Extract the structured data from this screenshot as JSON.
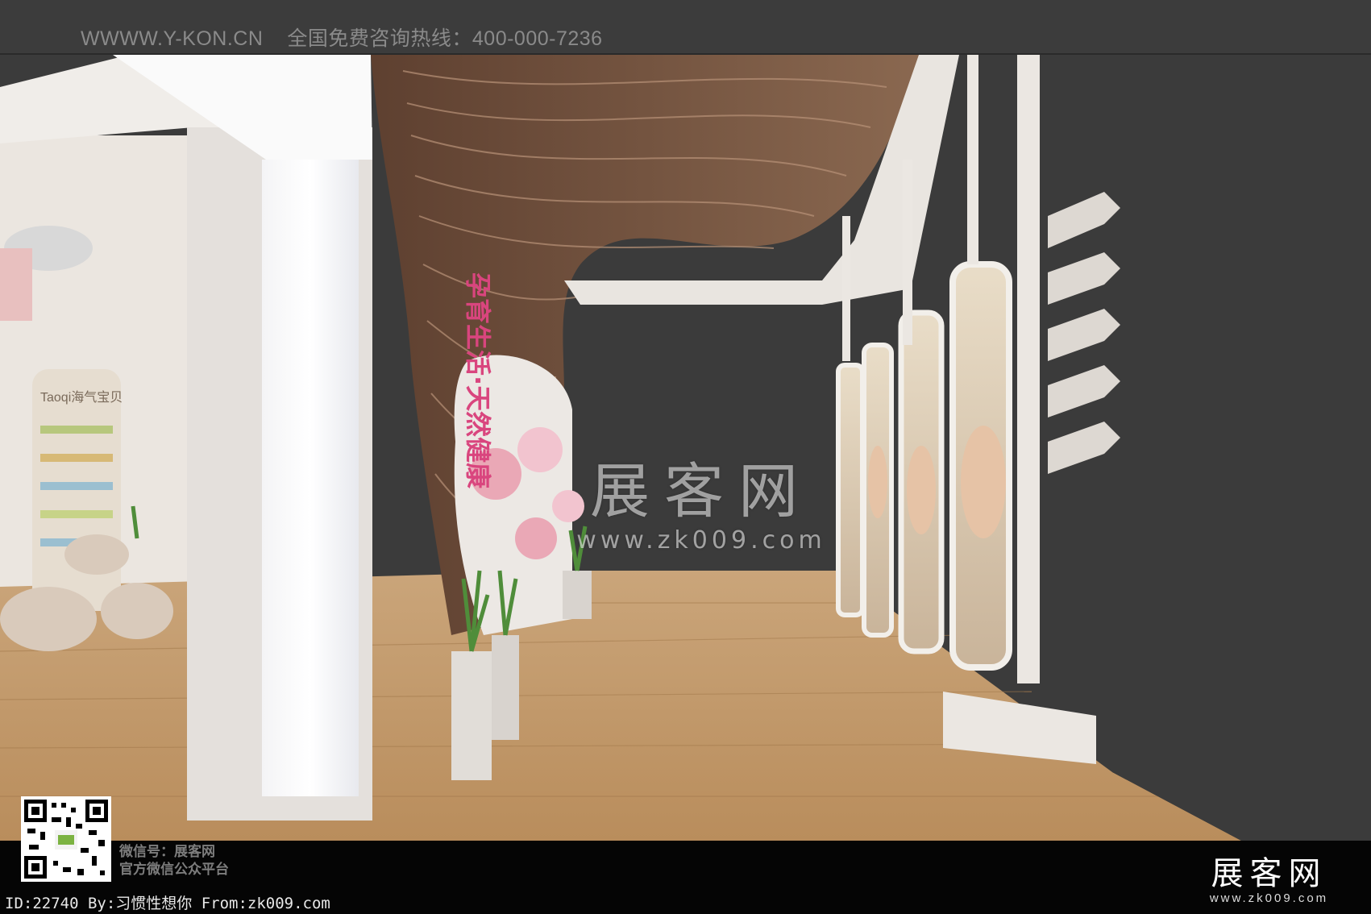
{
  "header": {
    "site": "WWWW.Y-KON.CN",
    "hotline": "全国免费咨询热线：400-000-7236"
  },
  "scene": {
    "sign_text": "Taoqi海气宝贝",
    "vertical_slogan": "孕育生活·天然健康"
  },
  "watermark": {
    "name": "展客网",
    "url": "www.zk009.com"
  },
  "footer": {
    "wechat_line1": "微信号：展客网",
    "wechat_line2": "官方微信公众平台",
    "id_line": "ID:22740 By:习惯性想你 From:zk009.com",
    "logo_name": "展客网",
    "logo_url": "www.zk009.com"
  },
  "colors": {
    "background": "#3b3b3b",
    "floor": "#c49a68",
    "wood_wall": "#7a5a45",
    "white_structure": "#eae6e1",
    "accent_pink": "#d9457e"
  }
}
